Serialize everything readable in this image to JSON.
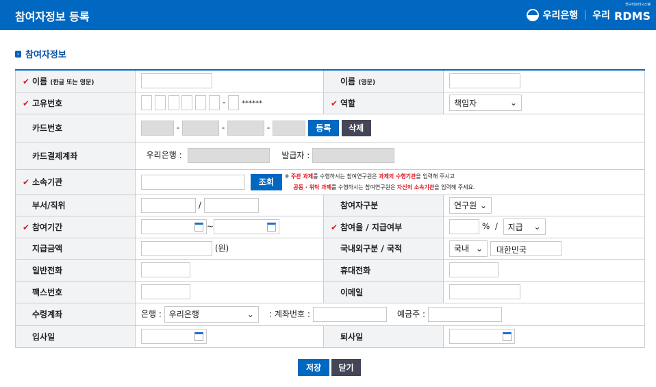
{
  "header": {
    "title": "참여자정보 등록",
    "bank_logo": "우리은행",
    "rdms_logo_prefix": "우리",
    "rdms_logo": "RDMS",
    "rdms_sub": "연구비관리시스템"
  },
  "section_title": "참여자정보",
  "labels": {
    "name_kr": "이름",
    "name_kr_note": "(한글 또는 영문)",
    "name_en": "이름",
    "name_en_note": "(영문)",
    "id_no": "고유번호",
    "role": "역할",
    "card_no": "카드번호",
    "card_account": "카드결제계좌",
    "affiliation": "소속기관",
    "dept_pos": "부서/직위",
    "participant_type": "참여자구분",
    "period": "참여기간",
    "rate_pay": "참여율 / 지급여부",
    "pay_amount": "지급금액",
    "domestic_nation": "국내외구분 / 국적",
    "phone": "일반전화",
    "mobile": "휴대전화",
    "fax": "팩스번호",
    "email": "이메일",
    "account": "수령계좌",
    "join_date": "입사일",
    "leave_date": "퇴사일"
  },
  "values": {
    "id_mask": "******",
    "role": "책임자",
    "card_register": "등록",
    "card_delete": "삭제",
    "card_bank": "우리은행 :",
    "issuer": "발급자 :",
    "lookup": "조회",
    "dash": "-",
    "slash": "/",
    "tilde": "~",
    "participant_type": "연구원",
    "percent": "%",
    "pay": "지급",
    "won": "(원)",
    "domestic": "국내",
    "nation": "대한민국",
    "bank_label": "은행 :",
    "bank": "우리은행",
    "acct_no_label": ": 계좌번호 :",
    "holder_label": "예금주 :"
  },
  "note": {
    "mark": "※",
    "l1a": "주관 과제",
    "l1b": "를 수행하시는 참여연구원은 ",
    "l1c": "과제의 수행기관",
    "l1d": "을 입력해 주시고",
    "l2a": "공동 · 위탁 과제",
    "l2b": "를 수행하시는 참여연구원은 ",
    "l2c": "자신의 소속기관",
    "l2d": "을 입력해 주세요."
  },
  "footer": {
    "save": "저장",
    "close": "닫기"
  }
}
